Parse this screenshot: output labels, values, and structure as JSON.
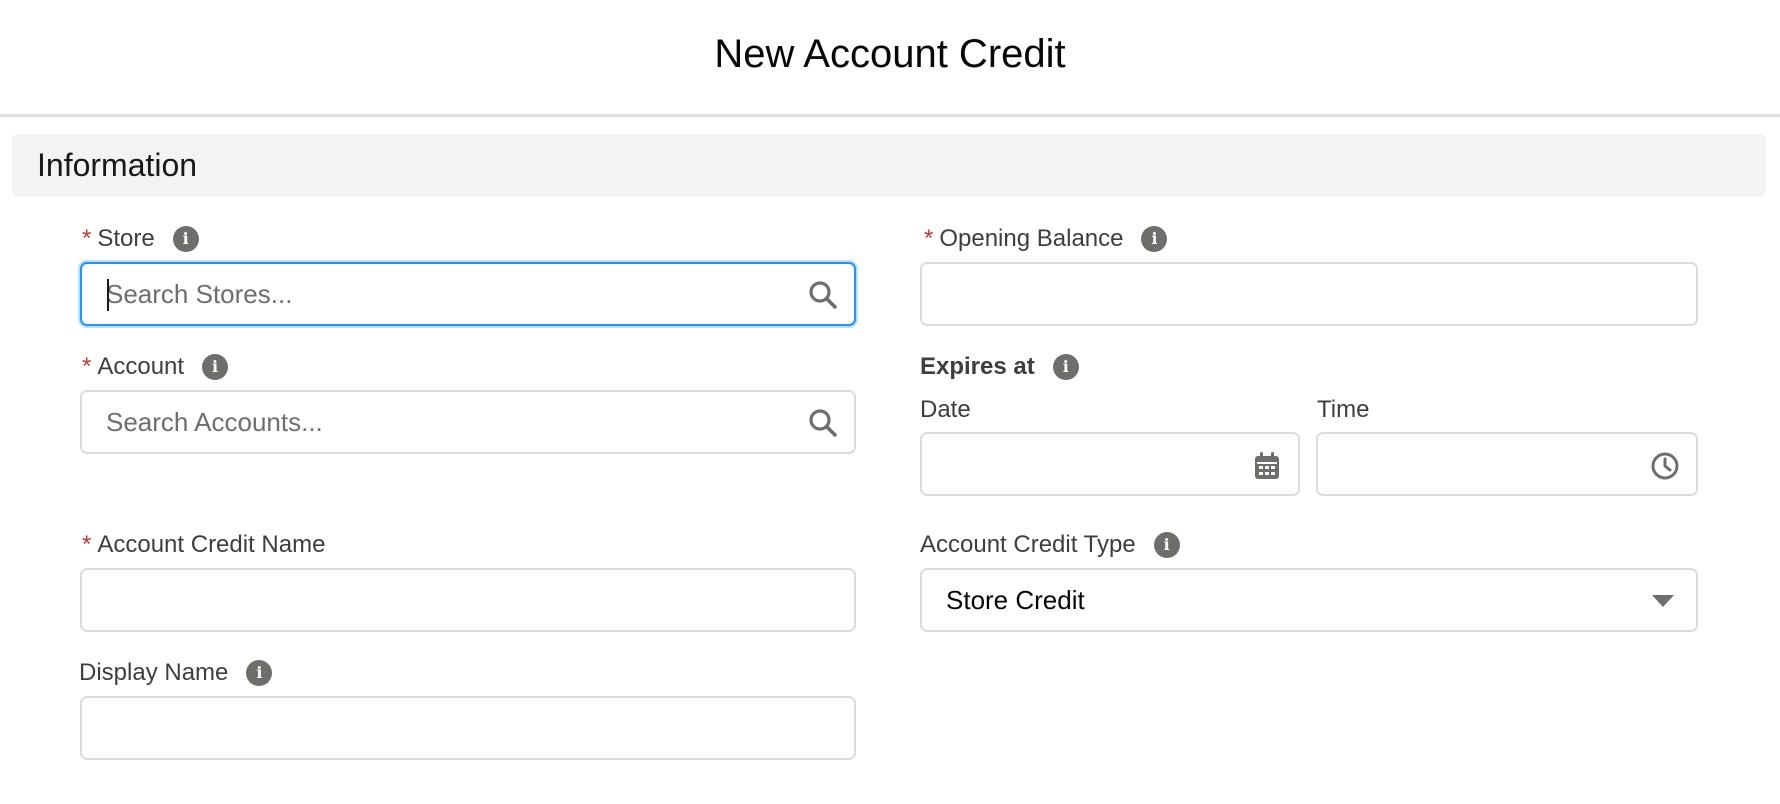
{
  "modal": {
    "title": "New Account Credit"
  },
  "section": {
    "title": "Information"
  },
  "fields": {
    "store": {
      "required_mark": "*",
      "label": "Store",
      "placeholder": "Search Stores...",
      "info": "i"
    },
    "account": {
      "required_mark": "*",
      "label": "Account",
      "placeholder": "Search Accounts...",
      "info": "i"
    },
    "account_credit_name": {
      "required_mark": "*",
      "label": "Account Credit Name",
      "value": ""
    },
    "display_name": {
      "label": "Display Name",
      "value": "",
      "info": "i"
    },
    "opening_balance": {
      "required_mark": "*",
      "label": "Opening Balance",
      "value": "",
      "info": "i"
    },
    "expires_at": {
      "label": "Expires at",
      "info": "i",
      "date_label": "Date",
      "time_label": "Time",
      "date_value": "",
      "time_value": ""
    },
    "account_credit_type": {
      "label": "Account Credit Type",
      "selected": "Store Credit",
      "info": "i"
    }
  },
  "icons": {
    "search": "search-icon",
    "calendar": "calendar-icon",
    "clock": "clock-icon",
    "dropdown": "chevron-down-icon",
    "info": "info-icon"
  },
  "colors": {
    "required": "#c23934",
    "focus_border": "#1b96ff",
    "icon_gray": "#706e6b"
  }
}
